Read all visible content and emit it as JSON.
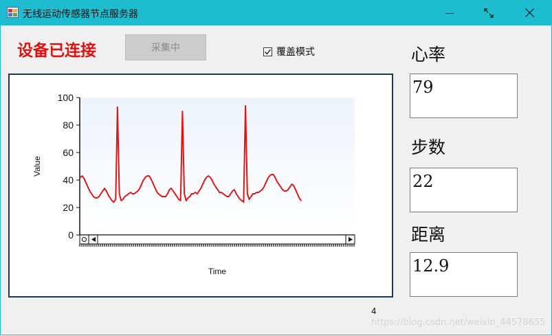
{
  "window": {
    "title": "无线运动传感器节点服务器",
    "titlebar_color": "#1ebccf"
  },
  "controls": {
    "status_text": "设备已连接",
    "status_color": "#e01010",
    "collect_button_label": "采集中",
    "collect_button_disabled": true,
    "overlay_mode_label": "覆盖模式",
    "overlay_mode_checked": true
  },
  "metrics": {
    "heart_rate_label": "心率",
    "heart_rate_value": "79",
    "steps_label": "步数",
    "steps_value": "22",
    "distance_label": "距离",
    "distance_value": "12.9"
  },
  "footer": {
    "count_text": "4",
    "watermark": "https://blog.csdn.net/weixin_44578655"
  },
  "icons": {
    "minimize": "minimize-icon",
    "restore": "restore-icon",
    "close": "close-icon",
    "app": "app-icon",
    "checkbox_check": "check-icon",
    "scroll_left": "scroll-left-icon",
    "scroll_right": "scroll-right-icon",
    "zoom_reset": "zoom-reset-icon"
  },
  "chart_data": {
    "type": "line",
    "xlabel": "Time",
    "ylabel": "Value",
    "ylim": [
      0,
      100
    ],
    "yticks": [
      "0",
      "20",
      "40",
      "60",
      "80",
      "100"
    ],
    "line_color": "#e01414",
    "series": [
      {
        "values": [
          42,
          43,
          41,
          38,
          35,
          32,
          30,
          28,
          27,
          27,
          28,
          30,
          32,
          34,
          32,
          29,
          27,
          25,
          24,
          26,
          93,
          30,
          25,
          26,
          28,
          29,
          30,
          31,
          30,
          30,
          31,
          32,
          34,
          37,
          40,
          42,
          43,
          43,
          41,
          38,
          35,
          32,
          30,
          29,
          28,
          28,
          28,
          30,
          33,
          34,
          32,
          30,
          28,
          26,
          25,
          90,
          30,
          25,
          27,
          28,
          30,
          30,
          31,
          30,
          32,
          34,
          37,
          40,
          42,
          43,
          42,
          40,
          37,
          35,
          33,
          31,
          31,
          30,
          29,
          28,
          28,
          30,
          32,
          33,
          30,
          28,
          26,
          25,
          24,
          94,
          30,
          26,
          28,
          30,
          30,
          31,
          31,
          32,
          33,
          35,
          38,
          41,
          43,
          44,
          44,
          42,
          39,
          37,
          35,
          33,
          32,
          32,
          33,
          35,
          37,
          36,
          33,
          30,
          27,
          25
        ]
      }
    ]
  }
}
